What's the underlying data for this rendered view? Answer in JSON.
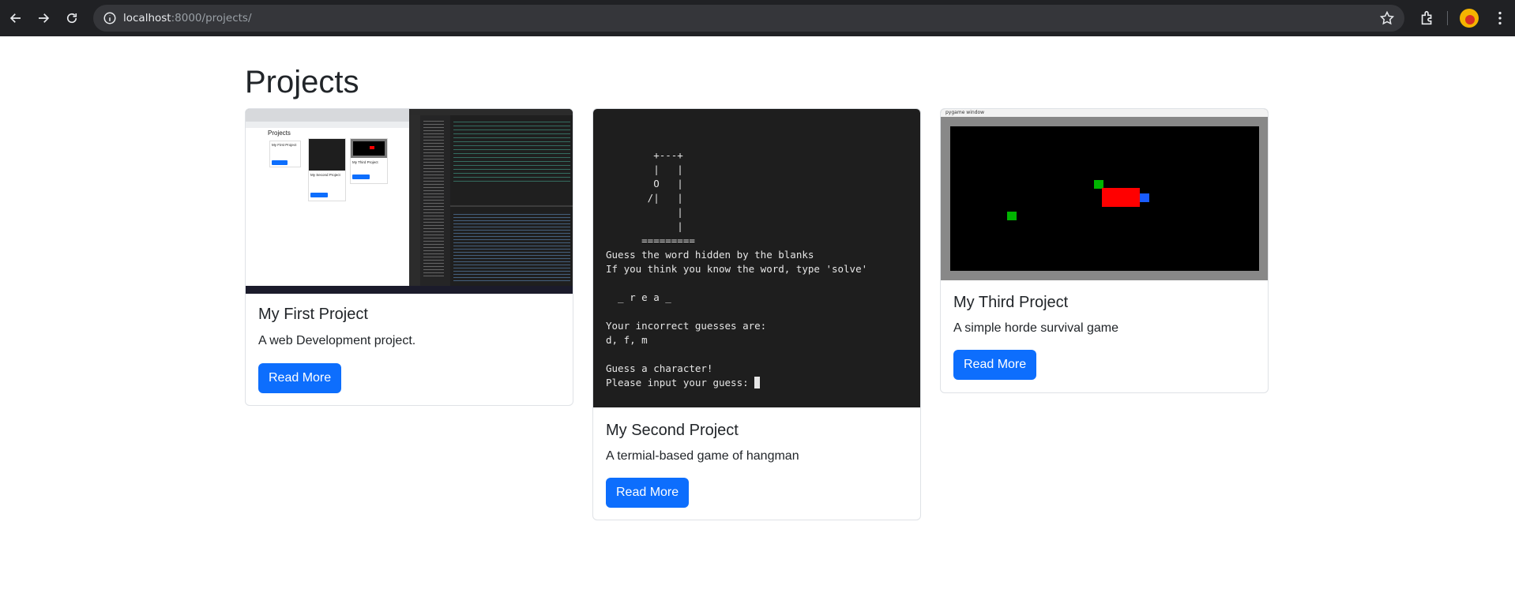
{
  "browser": {
    "url_host": "localhost",
    "url_path": ":8000/projects/",
    "icons": [
      "back-arrow-icon",
      "forward-arrow-icon",
      "reload-icon",
      "site-info-icon",
      "bookmark-star-icon",
      "extensions-icon",
      "profile-avatar",
      "kebab-menu-icon"
    ]
  },
  "page": {
    "title": "Projects"
  },
  "projects": [
    {
      "title": "My First Project",
      "description": "A web Development project.",
      "button": "Read More",
      "image": "screenshot-thumbnail",
      "thumb": {
        "heading": "Projects",
        "card1": "My First Project",
        "card2": "My Second Project",
        "card3": "My Third Project"
      }
    },
    {
      "title": "My Second Project",
      "description": "A termial-based game of hangman",
      "button": "Read More",
      "image": "hangman-terminal",
      "terminal_lines": [
        "        +---+",
        "        |   |",
        "        O   |",
        "       /|   |",
        "            |",
        "            |",
        "      =========",
        "Guess the word hidden by the blanks",
        "If you think you know the word, type 'solve'",
        "",
        "  _ r e a _",
        "",
        "Your incorrect guesses are:",
        "d, f, m",
        "",
        "Guess a character!",
        "Please input your guess: "
      ]
    },
    {
      "title": "My Third Project",
      "description": "A simple horde survival game",
      "button": "Read More",
      "image": "pygame-window",
      "window_title": "pygame window",
      "colors": {
        "player": "#ff0000",
        "enemy": "#00b400",
        "projectile": "#1a5cff"
      }
    }
  ],
  "theme": {
    "primary": "#0d6efd",
    "chrome_bg": "#202124",
    "omnibox_bg": "#35363a"
  }
}
